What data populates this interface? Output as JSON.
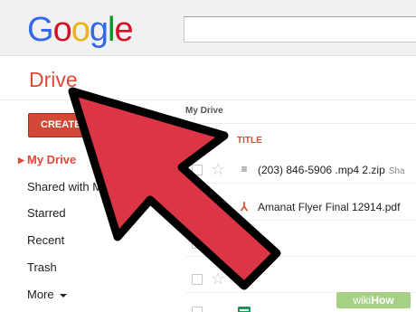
{
  "header": {
    "logo_text": "Google",
    "search": {
      "placeholder": "",
      "value": ""
    }
  },
  "drive": {
    "title": "Drive"
  },
  "sidebar": {
    "create_label": "CREATE",
    "items": [
      {
        "label": "My Drive",
        "active": true
      },
      {
        "label": "Shared with Me",
        "active": false
      },
      {
        "label": "Starred",
        "active": false
      },
      {
        "label": "Recent",
        "active": false
      },
      {
        "label": "Trash",
        "active": false
      },
      {
        "label": "More",
        "active": false
      }
    ]
  },
  "content": {
    "breadcrumb": "My Drive",
    "column_title": "TITLE",
    "files": [
      {
        "name": "(203) 846-5906 .mp4 2.zip",
        "type": "zip",
        "shared": "Sha",
        "icon": "zip-icon"
      },
      {
        "name": "Amanat Flyer Final 12914.pdf",
        "type": "pdf",
        "icon": "pdf-icon"
      },
      {
        "name": "",
        "type": "spreadsheet",
        "icon": "spreadsheet-icon"
      },
      {
        "name": "",
        "type": "spreadsheet",
        "icon": "spreadsheet-icon"
      },
      {
        "name": "",
        "type": "spreadsheet",
        "icon": "spreadsheet-icon"
      }
    ]
  },
  "overlay": {
    "arrow_color": "#dc3545",
    "arrow_outline": "#000000",
    "icon": "pointer-arrow-icon"
  },
  "watermark": {
    "part1": "wiki",
    "part2": "How"
  },
  "colors": {
    "accent": "#dd4b39",
    "create_button": "#d14836",
    "spreadsheet": "#0f9d58"
  }
}
